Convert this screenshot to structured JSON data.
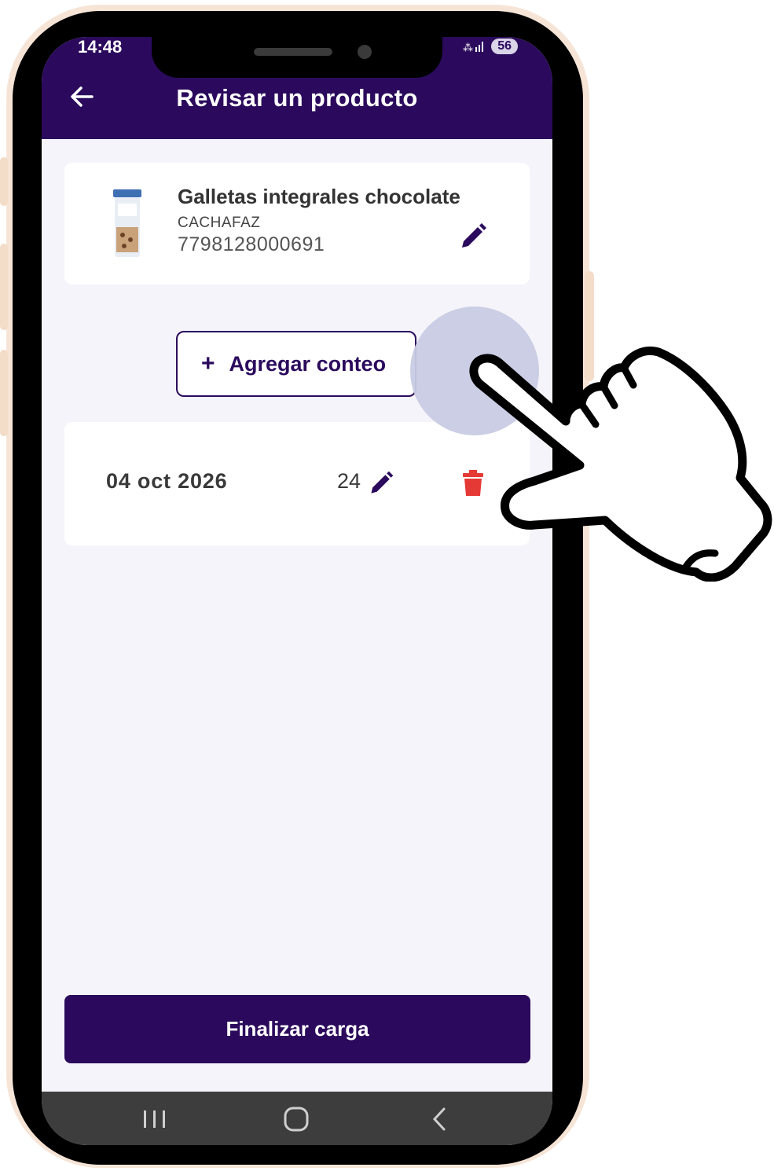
{
  "status_bar": {
    "time": "14:48",
    "battery": "56"
  },
  "header": {
    "title": "Revisar un producto"
  },
  "product": {
    "name": "Galletas integrales chocolate",
    "brand": "CACHAFAZ",
    "code": "7798128000691"
  },
  "add_count": {
    "plus": "+",
    "label": "Agregar conteo"
  },
  "counts": [
    {
      "date": "04 oct 2026",
      "quantity": "24"
    }
  ],
  "footer": {
    "finalize_label": "Finalizar carga"
  },
  "colors": {
    "primary": "#2b0a5d",
    "background": "#f5f4fa",
    "delete": "#e53935",
    "touch": "#c8cbe3"
  },
  "icons": {
    "back": "back-arrow-icon",
    "edit": "pencil-icon",
    "delete": "trash-icon",
    "nav_recent": "recent-apps-icon",
    "nav_home": "home-icon",
    "nav_back": "nav-back-icon"
  }
}
